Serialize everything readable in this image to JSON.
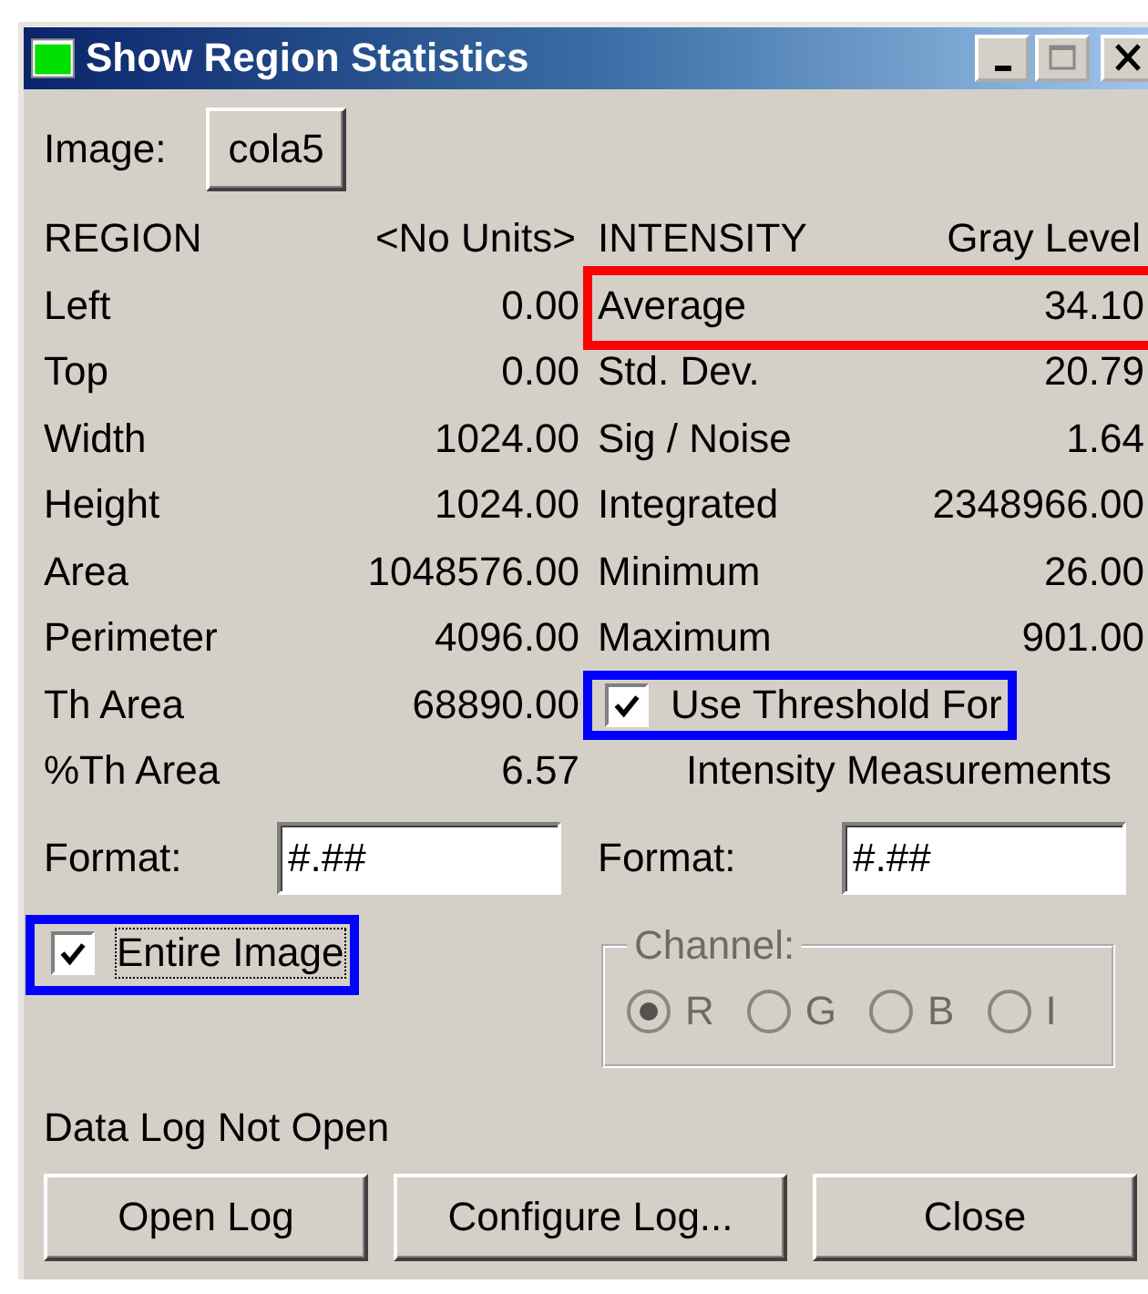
{
  "window": {
    "title": "Show Region Statistics"
  },
  "image": {
    "label": "Image:",
    "button": "cola5"
  },
  "region": {
    "header": "REGION",
    "units": "<No Units>",
    "rows": [
      {
        "label": "Left",
        "value": "0.00"
      },
      {
        "label": "Top",
        "value": "0.00"
      },
      {
        "label": "Width",
        "value": "1024.00"
      },
      {
        "label": "Height",
        "value": "1024.00"
      },
      {
        "label": "Area",
        "value": "1048576.00"
      },
      {
        "label": "Perimeter",
        "value": "4096.00"
      },
      {
        "label": "Th Area",
        "value": "68890.00"
      },
      {
        "label": "%Th Area",
        "value": "6.57"
      }
    ],
    "format": {
      "label": "Format:",
      "value": "#.##"
    }
  },
  "intensity": {
    "header": "INTENSITY",
    "units": "Gray Level",
    "rows": [
      {
        "label": "Average",
        "value": "34.10",
        "color": "#ff0000"
      },
      {
        "label": "Std. Dev.",
        "value": "20.79"
      },
      {
        "label": "Sig / Noise",
        "value": "1.64"
      },
      {
        "label": "Integrated",
        "value": "2348966.00"
      },
      {
        "label": "Minimum",
        "value": "26.00"
      },
      {
        "label": "Maximum",
        "value": "901.00"
      }
    ],
    "threshold": {
      "label": "Use Threshold For",
      "continuation": "Intensity Measurements",
      "checked": true,
      "color": "#0000ff"
    },
    "format": {
      "label": "Format:",
      "value": "#.##"
    }
  },
  "entire_image": {
    "label": "Entire Image",
    "checked": true,
    "color": "#0000ff"
  },
  "channel": {
    "label": "Channel:",
    "disabled": true,
    "options": [
      {
        "label": "R",
        "selected": true
      },
      {
        "label": "G",
        "selected": false
      },
      {
        "label": "B",
        "selected": false
      },
      {
        "label": "I",
        "selected": false
      }
    ]
  },
  "status": "Data Log Not Open",
  "buttons": [
    "Open Log",
    "Configure Log...",
    "Close"
  ]
}
